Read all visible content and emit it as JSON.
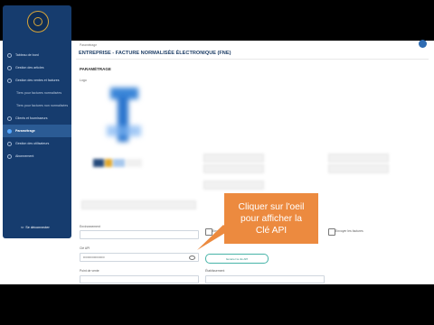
{
  "breadcrumb": "Paramétrage",
  "page_title": "ENTREPRISE - FACTURE NORMALISÉE ÉLECTRONIQUE (FNE)",
  "section_title": "PARAMÉTRAGE",
  "logo_label": "Logo",
  "sidebar": {
    "items": [
      {
        "label": "Tableau de bord",
        "sub": false,
        "active": false
      },
      {
        "label": "Gestion des articles",
        "sub": false,
        "active": false
      },
      {
        "label": "Gestion des ventes et factures",
        "sub": false,
        "active": false
      },
      {
        "label": "Tiers pour factures normalisées",
        "sub": true,
        "active": false
      },
      {
        "label": "Tiers pour factures non normalisées",
        "sub": true,
        "active": false
      },
      {
        "label": "Clients et fournisseurs",
        "sub": false,
        "active": false
      },
      {
        "label": "Paramétrage",
        "sub": false,
        "active": true
      },
      {
        "label": "Gestion des utilisateurs",
        "sub": false,
        "active": false
      },
      {
        "label": "Abonnement",
        "sub": false,
        "active": false
      }
    ],
    "logout_label": "Se déconnecter"
  },
  "form": {
    "environment_label": "Environnement",
    "checkbox_left_label": "Environnement",
    "checkbox_right_label": "Envoyer les factures",
    "api_key_label": "Clé API",
    "api_key_value": "••••••••••••••••••••",
    "generate_button": "Générer la clé API",
    "bottom_left_label": "Point de vente",
    "bottom_right_label": "Établissement"
  },
  "tooltip": {
    "line1": "Cliquer sur l'oeil",
    "line2": "pour afficher la",
    "line3": "Clé API"
  },
  "colors": {
    "sidebar": "#163c6e",
    "accent": "#2f6cb2",
    "tooltip": "#ec8a3f",
    "button": "#47b4a8"
  }
}
